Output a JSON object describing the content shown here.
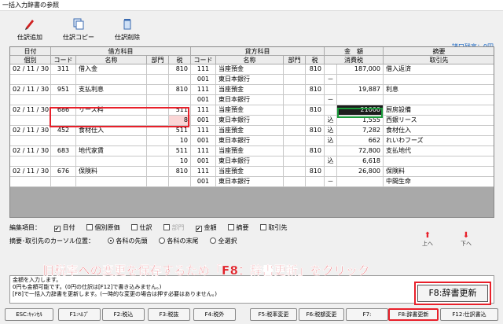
{
  "window": {
    "title": "一括入力辞書の参照"
  },
  "toolbar": {
    "add_label": "仕訳追加",
    "copy_label": "仕訳コピー",
    "delete_label": "仕訳削除",
    "balance": "諸口残高：0円"
  },
  "grid": {
    "group_headers": {
      "date": "日付",
      "debit": "借方科目",
      "credit": "貸方科目",
      "amount": "金　額",
      "summary": "摘要"
    },
    "col_headers": {
      "kobetsu": "個別",
      "d_code": "コード",
      "d_name": "名称",
      "d_dept": "部門",
      "d_tax": "税",
      "c_code": "コード",
      "c_name": "名称",
      "c_dept": "部門",
      "c_tax": "税",
      "tax_amt": "消費税",
      "partner": "取引先"
    },
    "rows": [
      {
        "date": "02 / 11 / 30",
        "d_code": "311",
        "d_name": "借入金",
        "d_dept": "",
        "d_tax": "810",
        "c_code": "111",
        "c_name": "当座預金",
        "c_dept": "",
        "c_tax": "810",
        "amt_flag": "",
        "amount": "187,000",
        "summary": "借入返済",
        "d_code2": "",
        "d_tax2": "",
        "c_code2": "001",
        "c_name2": "東日本銀行",
        "amt_flag2": "－",
        "amount2": "",
        "summary2": ""
      },
      {
        "date": "02 / 11 / 30",
        "d_code": "951",
        "d_name": "支払利息",
        "d_dept": "",
        "d_tax": "810",
        "c_code": "111",
        "c_name": "当座預金",
        "c_dept": "",
        "c_tax": "810",
        "amt_flag": "",
        "amount": "19,887",
        "summary": "利息",
        "d_code2": "",
        "d_tax2": "",
        "c_code2": "001",
        "c_name2": "東日本銀行",
        "amt_flag2": "－",
        "amount2": "",
        "summary2": ""
      },
      {
        "date": "02 / 11 / 30",
        "d_code": "686",
        "d_name": "リース料",
        "d_dept": "",
        "d_tax": "511",
        "c_code": "111",
        "c_name": "当座預金",
        "c_dept": "",
        "c_tax": "810",
        "amt_flag": "",
        "amount": "21000",
        "summary": "厨房設備",
        "d_code2": "",
        "d_tax2": "8",
        "c_code2": "001",
        "c_name2": "東日本銀行",
        "amt_flag2": "込",
        "amount2": "1,555",
        "summary2": "西銀リース"
      },
      {
        "date": "02 / 11 / 30",
        "d_code": "452",
        "d_name": "食材仕入",
        "d_dept": "",
        "d_tax": "511",
        "c_code": "111",
        "c_name": "当座預金",
        "c_dept": "",
        "c_tax": "810",
        "amt_flag": "込",
        "amount": "7,282",
        "summary": "食材仕入",
        "d_code2": "",
        "d_tax2": "10",
        "c_code2": "001",
        "c_name2": "東日本銀行",
        "amt_flag2": "込",
        "amount2": "662",
        "summary2": "れいわフーズ"
      },
      {
        "date": "02 / 11 / 30",
        "d_code": "683",
        "d_name": "地代家賃",
        "d_dept": "",
        "d_tax": "511",
        "c_code": "111",
        "c_name": "当座預金",
        "c_dept": "",
        "c_tax": "810",
        "amt_flag": "",
        "amount": "72,800",
        "summary": "支払地代",
        "d_code2": "",
        "d_tax2": "10",
        "c_code2": "001",
        "c_name2": "東日本銀行",
        "amt_flag2": "込",
        "amount2": "6,618",
        "summary2": ""
      },
      {
        "date": "02 / 11 / 30",
        "d_code": "676",
        "d_name": "保険料",
        "d_dept": "",
        "d_tax": "810",
        "c_code": "111",
        "c_name": "当座預金",
        "c_dept": "",
        "c_tax": "810",
        "amt_flag": "",
        "amount": "26,800",
        "summary": "保険料",
        "d_code2": "",
        "d_tax2": "",
        "c_code2": "001",
        "c_name2": "東日本銀行",
        "amt_flag2": "－",
        "amount2": "",
        "summary2": "中間生命"
      }
    ]
  },
  "edit_items": {
    "label": "編集項目：",
    "items": [
      {
        "label": "日付",
        "checked": true,
        "enabled": true
      },
      {
        "label": "個別原価",
        "checked": false,
        "enabled": true
      },
      {
        "label": "仕訳",
        "checked": false,
        "enabled": true
      },
      {
        "label": "部門",
        "checked": false,
        "enabled": false
      },
      {
        "label": "金額",
        "checked": true,
        "enabled": true
      },
      {
        "label": "摘要",
        "checked": false,
        "enabled": true
      },
      {
        "label": "取引先",
        "checked": false,
        "enabled": true
      }
    ]
  },
  "cursor_pos": {
    "label": "摘要･取引先のカーソル位置：",
    "options": [
      {
        "label": "各科の先頭",
        "selected": true
      },
      {
        "label": "各科の末尾",
        "selected": false
      },
      {
        "label": "全選択",
        "selected": false
      }
    ]
  },
  "nav": {
    "up_label": "上へ",
    "down_label": "下へ",
    "up_arrow": "⬆",
    "down_arrow": "⬇"
  },
  "message": {
    "line1": "金額を入力します。",
    "line2": "0円も金額可能です。(0円の仕訳は[F12]で書き込みません。)",
    "line3": "[F8]で一括入力辞書を更新します。(一時的な変更の場合は押す必要はありません。)"
  },
  "annotation": {
    "text": "旧税率への変更を保存するため「F8：辞書更新」をクリック",
    "callout_label": "F8:辞書更新"
  },
  "fkeys": [
    "ESC:ｷｬﾝｾﾙ",
    "F1:ﾍﾙﾌﾟ",
    "F2:税込",
    "F3:税抜",
    "F4:税外",
    "F5:税率変更",
    "F6:税額変更",
    "F7:",
    "F8:辞書更新",
    "F12:仕訳書込"
  ],
  "colors": {
    "highlight": "#e8202a",
    "focus": "#1a9c3a",
    "tax_cell": "#fbd6d6"
  }
}
